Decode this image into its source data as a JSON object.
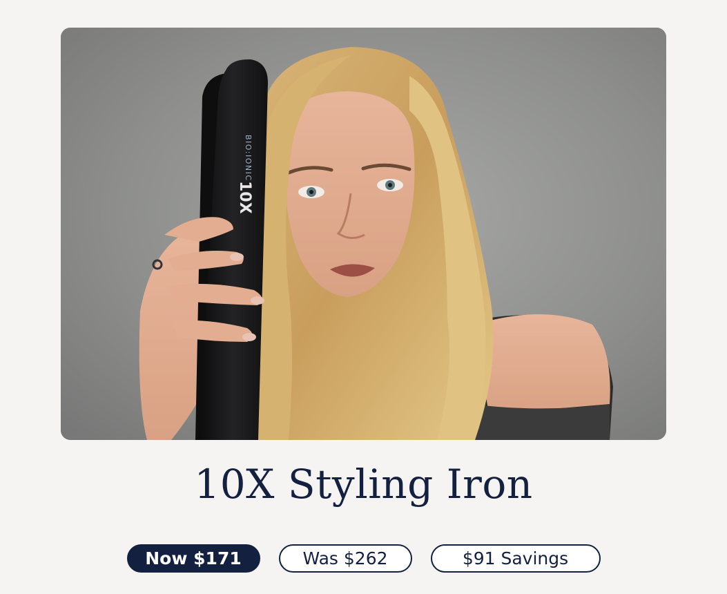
{
  "product": {
    "title": "10X Styling Iron",
    "image_alt": "Woman with wavy blonde hair holding a black styling iron",
    "iron_brand_text": "BIO:IONIC",
    "iron_model_text": "10X"
  },
  "pricing": {
    "now_label": "Now $171",
    "was_label": "Was $262",
    "savings_label": "$91 Savings"
  },
  "colors": {
    "navy": "#14203f",
    "page_background": "#f5f4f2",
    "pill_background": "#ffffff"
  }
}
